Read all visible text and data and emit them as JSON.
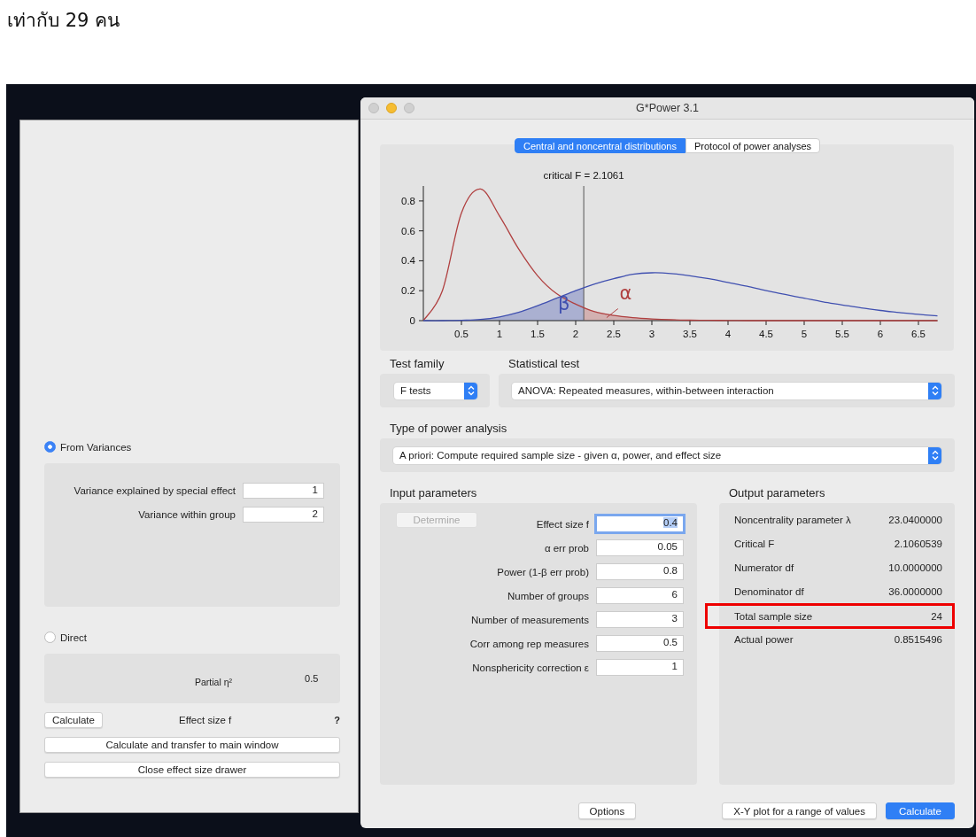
{
  "page_text": "เท่ากับ 29 คน",
  "drawer": {
    "options": [
      {
        "label": "From Variances",
        "selected": true
      },
      {
        "label": "Direct",
        "selected": false
      }
    ],
    "variances": [
      {
        "label": "Variance explained by special effect",
        "value": "1"
      },
      {
        "label": "Variance within group",
        "value": "2"
      }
    ],
    "direct": {
      "label": "Partial η²",
      "value": "0.5"
    },
    "calculate_button": "Calculate",
    "effect_size_label": "Effect size f",
    "effect_size_value": "?",
    "buttons": [
      "Calculate and transfer to main window",
      "Close effect size drawer"
    ]
  },
  "window": {
    "title": "G*Power 3.1"
  },
  "tabs": [
    {
      "label": "Central and noncentral distributions",
      "selected": true
    },
    {
      "label": "Protocol of power analyses",
      "selected": false
    }
  ],
  "chart": {
    "chart_data": {
      "type": "line",
      "x": [
        0,
        0.25,
        0.5,
        0.75,
        1,
        1.25,
        1.5,
        1.75,
        2,
        2.25,
        2.5,
        2.75,
        3,
        3.25,
        3.5,
        3.75,
        4,
        4.25,
        4.5,
        4.75,
        5,
        5.25,
        5.5,
        5.75,
        6,
        6.25,
        6.5,
        6.75
      ],
      "series": [
        {
          "color": "#b04040",
          "values": [
            0,
            0.2,
            0.72,
            0.88,
            0.7,
            0.48,
            0.3,
            0.18,
            0.11,
            0.06,
            0.035,
            0.02,
            0.011,
            0.006,
            0.003,
            0.002,
            0.001,
            0,
            0,
            0,
            0,
            0,
            0,
            0,
            0,
            0,
            0,
            0
          ]
        },
        {
          "color": "#4050b0",
          "values": [
            0,
            0,
            0.002,
            0.008,
            0.025,
            0.055,
            0.1,
            0.15,
            0.2,
            0.245,
            0.28,
            0.31,
            0.32,
            0.315,
            0.3,
            0.28,
            0.255,
            0.23,
            0.2,
            0.175,
            0.15,
            0.125,
            0.105,
            0.085,
            0.068,
            0.054,
            0.042,
            0.032
          ]
        }
      ],
      "xlim": [
        0,
        6.75
      ],
      "ylim": [
        0,
        0.9
      ],
      "xticks": [
        0.5,
        1,
        1.5,
        2,
        2.5,
        3,
        3.5,
        4,
        4.5,
        5,
        5.5,
        6,
        6.5
      ],
      "yticks": [
        0,
        0.2,
        0.4,
        0.6,
        0.8
      ],
      "ref_lines": [
        {
          "axis": "x",
          "value": 2.1061,
          "label": "critical F = 2.1061"
        }
      ],
      "annotations": [
        "β",
        "α"
      ]
    }
  },
  "test_family": {
    "label": "Test family",
    "value": "F tests"
  },
  "statistical_test": {
    "label": "Statistical test",
    "value": "ANOVA: Repeated measures, within-between interaction"
  },
  "type_of_power_analysis": {
    "label": "Type of power analysis",
    "value": "A priori: Compute required sample size - given α, power, and effect size"
  },
  "input_parameters": {
    "title": "Input parameters",
    "determine_button": {
      "label": "Determine",
      "disabled": true
    },
    "fields": [
      {
        "label": "Effect size f",
        "value": "0.4",
        "focused": true
      },
      {
        "label": "α err prob",
        "value": "0.05",
        "focused": false
      },
      {
        "label": "Power (1-β err prob)",
        "value": "0.8",
        "focused": false
      },
      {
        "label": "Number of groups",
        "value": "6",
        "focused": false
      },
      {
        "label": "Number of measurements",
        "value": "3",
        "focused": false
      },
      {
        "label": "Corr among rep measures",
        "value": "0.5",
        "focused": false
      },
      {
        "label": "Nonsphericity correction ε",
        "value": "1",
        "focused": false
      }
    ]
  },
  "output_parameters": {
    "title": "Output parameters",
    "rows": [
      {
        "label": "Noncentrality parameter λ",
        "value": "23.0400000",
        "highlighted": false
      },
      {
        "label": "Critical F",
        "value": "2.1060539",
        "highlighted": false
      },
      {
        "label": "Numerator df",
        "value": "10.0000000",
        "highlighted": false
      },
      {
        "label": "Denominator df",
        "value": "36.0000000",
        "highlighted": false
      },
      {
        "label": "Total sample size",
        "value": "24",
        "highlighted": true
      },
      {
        "label": "Actual power",
        "value": "0.8515496",
        "highlighted": false
      }
    ]
  },
  "buttons": [
    {
      "label": "Options",
      "kind": "plain"
    },
    {
      "label": "X-Y plot for a range of values",
      "kind": "plain"
    },
    {
      "label": "Calculate",
      "kind": "primary"
    }
  ]
}
